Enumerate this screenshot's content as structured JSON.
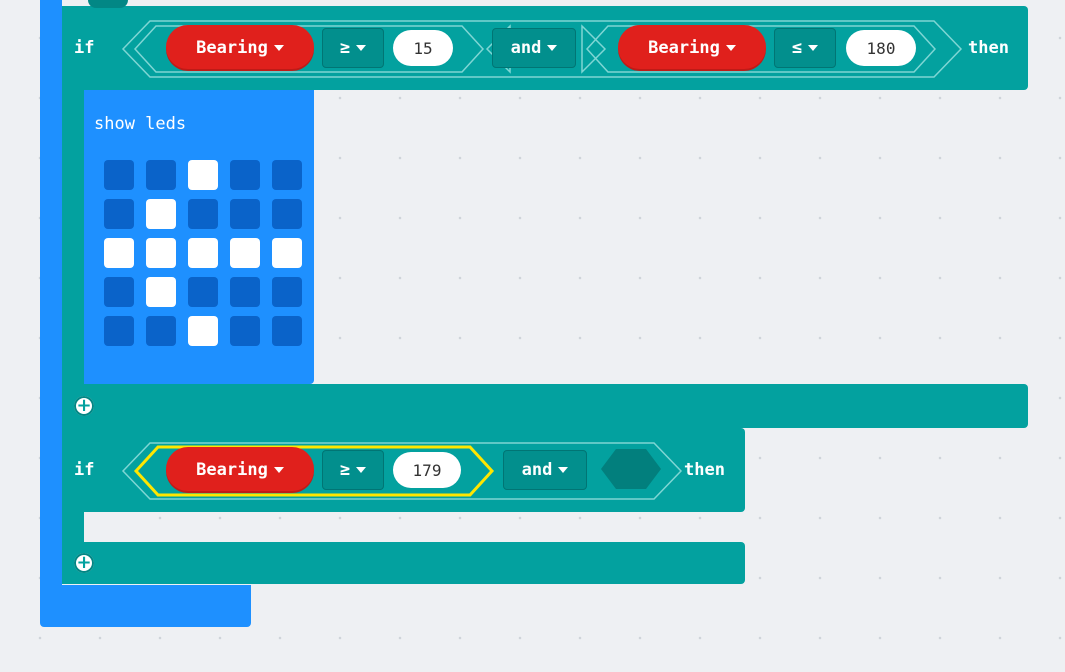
{
  "workspace": {
    "background": "#eef0f3"
  },
  "colors": {
    "logic": "#03a19f",
    "basic": "#1e90ff",
    "variable": "#e0201c",
    "highlight": "#ffe600"
  },
  "if_block_1": {
    "if_label": "if",
    "then_label": "then",
    "join_op": "and",
    "left": {
      "variable": "Bearing",
      "operator": "≥",
      "value": "15"
    },
    "right": {
      "variable": "Bearing",
      "operator": "≤",
      "value": "180"
    }
  },
  "show_leds": {
    "label": "show leds",
    "grid": [
      [
        0,
        0,
        1,
        0,
        0
      ],
      [
        0,
        1,
        0,
        0,
        0
      ],
      [
        1,
        1,
        1,
        1,
        1
      ],
      [
        0,
        1,
        0,
        0,
        0
      ],
      [
        0,
        0,
        1,
        0,
        0
      ]
    ]
  },
  "if_block_2": {
    "if_label": "if",
    "then_label": "then",
    "join_op": "and",
    "left": {
      "variable": "Bearing",
      "operator": "≥",
      "value": "179"
    },
    "right_empty": true
  },
  "icons": {
    "add": "plus-circle-icon",
    "dropdown": "caret-down-icon"
  }
}
